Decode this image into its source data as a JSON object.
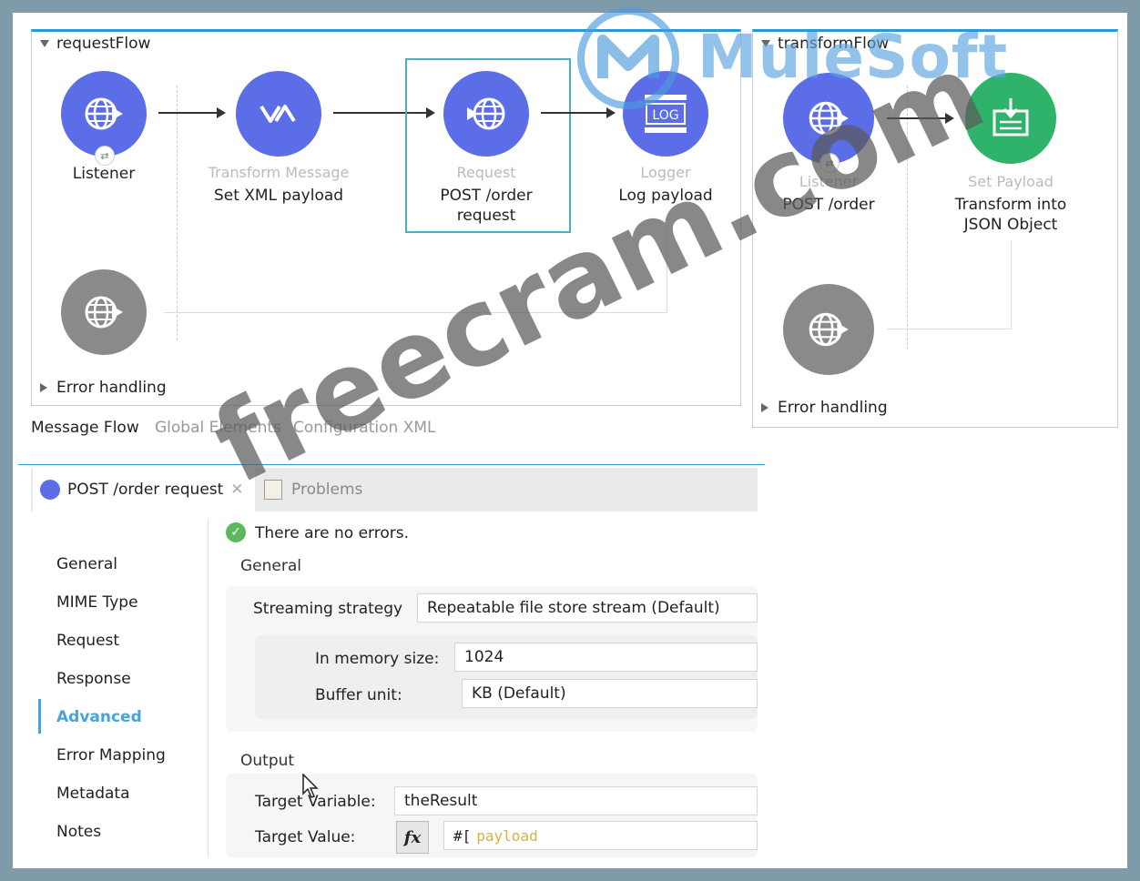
{
  "request_flow": {
    "title": "requestFlow",
    "nodes": [
      {
        "type": "",
        "name": "Listener",
        "icon": "globe-listener-icon"
      },
      {
        "type": "Transform Message",
        "name": "Set XML payload",
        "icon": "dataweave-icon"
      },
      {
        "type": "Request",
        "name": "POST /order\nrequest",
        "icon": "globe-request-icon"
      },
      {
        "type": "Logger",
        "name": "Log payload",
        "icon": "log-icon"
      }
    ],
    "error_handling": "Error handling"
  },
  "transform_flow": {
    "title": "transformFlow",
    "nodes": [
      {
        "type": "Listener",
        "name": "POST /order",
        "icon": "globe-listener-icon"
      },
      {
        "type": "Set Payload",
        "name": "Transform into\nJSON Object",
        "icon": "set-payload-icon"
      }
    ],
    "error_handling": "Error handling"
  },
  "editor_tabs": [
    "Message Flow",
    "Global Elements",
    "Configuration XML"
  ],
  "panel": {
    "tabs": [
      {
        "label": "POST /order request",
        "active": true
      },
      {
        "label": "Problems",
        "active": false
      }
    ],
    "nav": [
      "General",
      "MIME Type",
      "Request",
      "Response",
      "Advanced",
      "Error Mapping",
      "Metadata",
      "Notes"
    ],
    "active_nav": "Advanced",
    "status": "There are no errors.",
    "general_title": "General",
    "streaming_label": "Streaming strategy",
    "streaming_value": "Repeatable file store stream (Default)",
    "memory_label": "In memory size:",
    "memory_value": "1024",
    "buffer_label": "Buffer unit:",
    "buffer_value": "KB (Default)",
    "output_title": "Output",
    "target_variable_label": "Target Variable:",
    "target_variable_value": "theResult",
    "target_value_label": "Target Value:",
    "fx_label": "fx",
    "target_value_prefix": "#[",
    "target_value_expr": "payload"
  },
  "watermark": {
    "brand": "MuleSoft",
    "site": "freecram.com"
  },
  "colors": {
    "node_blue": "#5b6ee8",
    "node_green": "#2fb36a",
    "node_grey": "#8a8a8a",
    "accent": "#2a9bd0",
    "active_nav": "#4aa3d8",
    "expr": "#d4b24a"
  }
}
